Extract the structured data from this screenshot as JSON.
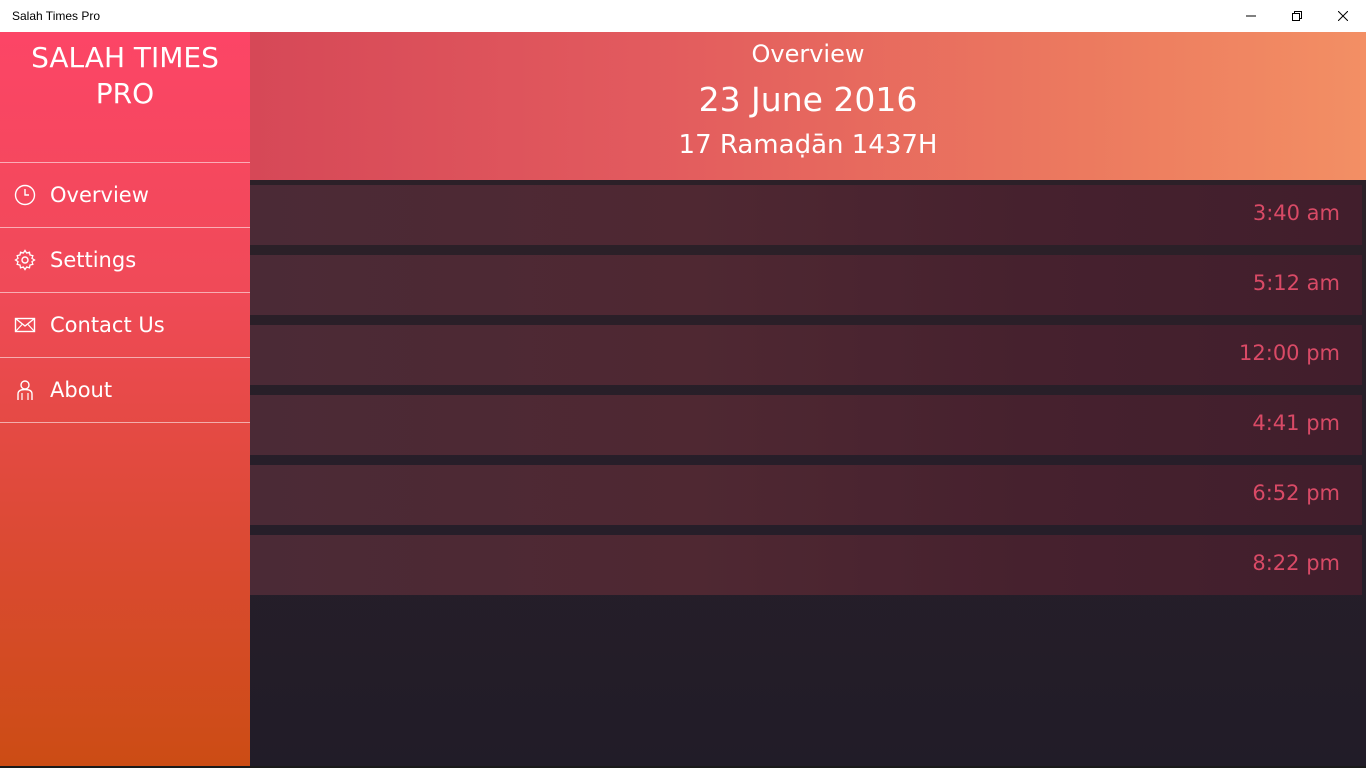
{
  "window": {
    "title": "Salah Times Pro"
  },
  "sidebar": {
    "brand": "SALAH TIMES\nPRO",
    "items": [
      {
        "label": "Overview",
        "icon": "clock-icon"
      },
      {
        "label": "Settings",
        "icon": "gear-icon"
      },
      {
        "label": "Contact Us",
        "icon": "envelope-icon"
      },
      {
        "label": "About",
        "icon": "person-icon"
      }
    ]
  },
  "header": {
    "title": "Overview",
    "date": "23 June 2016",
    "hijri": "17 Ramaḍān 1437H"
  },
  "prayers": [
    {
      "time": "3:40 am"
    },
    {
      "time": "5:12 am"
    },
    {
      "time": "12:00 pm"
    },
    {
      "time": "4:41 pm"
    },
    {
      "time": "6:52 pm"
    },
    {
      "time": "8:22 pm"
    }
  ],
  "colors": {
    "accent": "#fc4566",
    "time_text": "#d94a66",
    "background": "#231d29"
  }
}
